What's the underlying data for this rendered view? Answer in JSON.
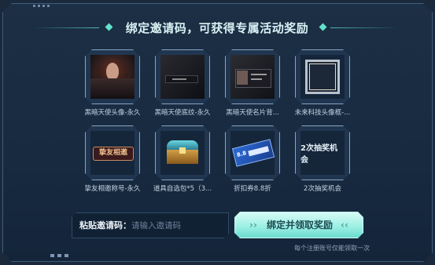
{
  "header": {
    "title": "绑定邀请码，可获得专属活动奖励"
  },
  "rewards": [
    {
      "label": "黑暗天使头像-永久",
      "art": "avatar"
    },
    {
      "label": "黑暗天使底纹-永久",
      "art": "dark-background"
    },
    {
      "label": "黑暗天使名片背...",
      "art": "name-card"
    },
    {
      "label": "未来科技头像框-...",
      "art": "avatar-frame"
    },
    {
      "label": "挚友相邀称号-永久",
      "art": "title-badge",
      "badge_text": "挚友相邀"
    },
    {
      "label": "道具自选包*5（3...",
      "art": "treasure-chest"
    },
    {
      "label": "折扣券8.8折",
      "art": "discount-coupon",
      "coupon_text": "8.8"
    },
    {
      "label": "2次抽奖机会",
      "art": "text-tile",
      "tile_text": "2次抽奖机会"
    }
  ],
  "invite": {
    "label": "粘贴邀请码：",
    "placeholder": "请输入邀请码",
    "value": ""
  },
  "bind_button": {
    "label": "绑定并领取奖励",
    "left_chevron": "››",
    "right_chevron": "‹‹"
  },
  "footnote": "每个注册账号仅能领取一次",
  "colors": {
    "accent": "#63e3cc",
    "button": "#9ef0e4",
    "panel": "#1c2f45"
  }
}
